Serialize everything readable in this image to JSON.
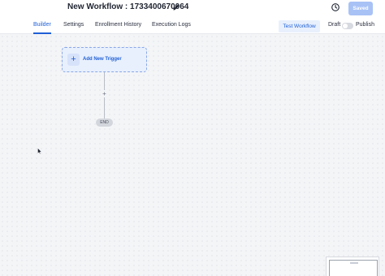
{
  "header": {
    "title": "New Workflow : 1733400670064",
    "edit_icon": "pencil-icon",
    "history_icon": "clock-history-icon",
    "saved_label": "Saved"
  },
  "tabs": [
    {
      "label": "Builder",
      "active": true
    },
    {
      "label": "Settings",
      "active": false
    },
    {
      "label": "Enrollment History",
      "active": false
    },
    {
      "label": "Execution Logs",
      "active": false
    }
  ],
  "actions": {
    "test_workflow_label": "Test Workflow",
    "draft_label": "Draft",
    "publish_label": "Publish",
    "published": false
  },
  "canvas": {
    "trigger_label": "Add New Trigger",
    "add_step_symbol": "+",
    "end_label": "END"
  },
  "colors": {
    "accent": "#1f5fd6",
    "saved_button": "#a8c2f6",
    "trigger_fill": "#e8f0fd",
    "canvas_bg": "#f4f5f7"
  }
}
